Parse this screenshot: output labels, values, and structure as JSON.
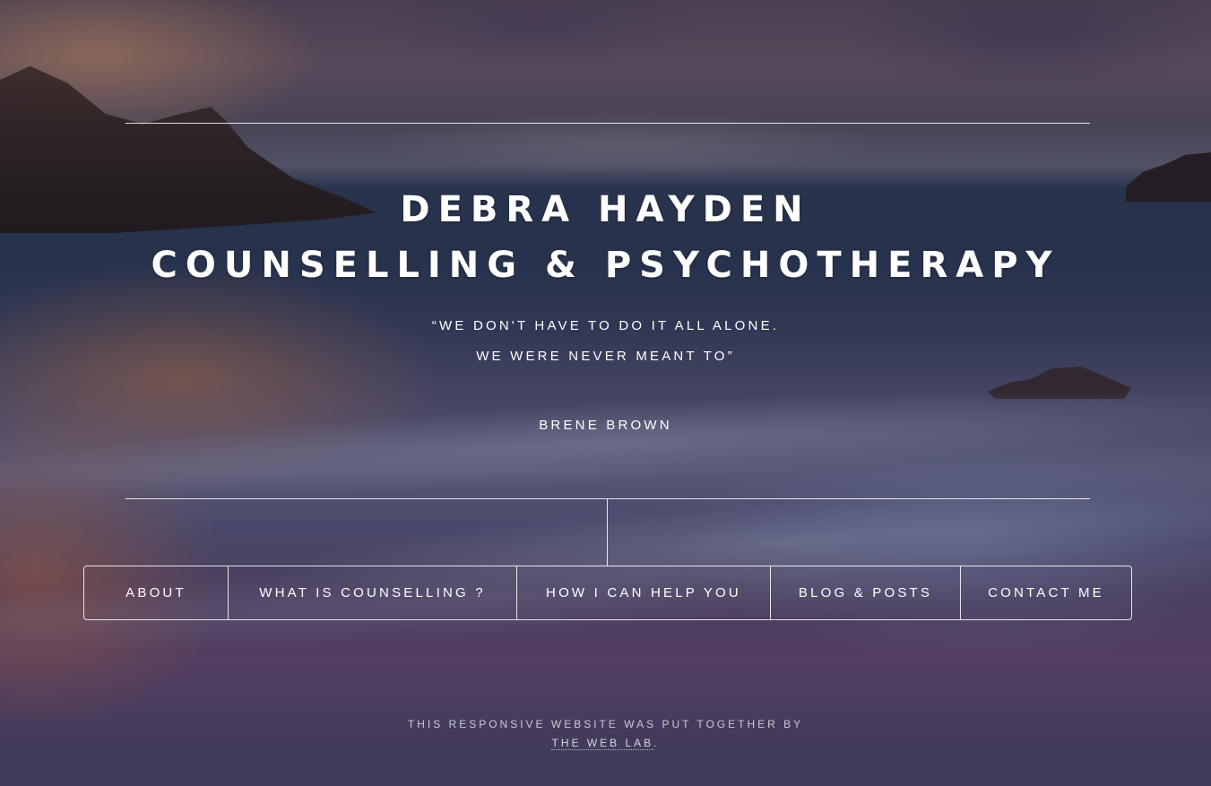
{
  "header": {
    "title_line1": "DEBRA HAYDEN",
    "title_line2": "COUNSELLING & PSYCHOTHERAPY"
  },
  "quote": {
    "line1": "“WE DON'T HAVE TO DO IT ALL ALONE.",
    "line2": "WE WERE NEVER MEANT TO”",
    "author": "BRENE BROWN"
  },
  "nav": {
    "items": [
      {
        "label": "ABOUT"
      },
      {
        "label": "WHAT IS COUNSELLING ?"
      },
      {
        "label": "HOW I CAN HELP YOU"
      },
      {
        "label": "BLOG & POSTS"
      },
      {
        "label": "CONTACT ME"
      }
    ]
  },
  "footer": {
    "text": "THIS RESPONSIVE WEBSITE WAS PUT TOGETHER BY",
    "link_label": "THE WEB LAB",
    "suffix": "."
  },
  "colors": {
    "text": "#ffffff",
    "background_overlay": "#19162866"
  }
}
